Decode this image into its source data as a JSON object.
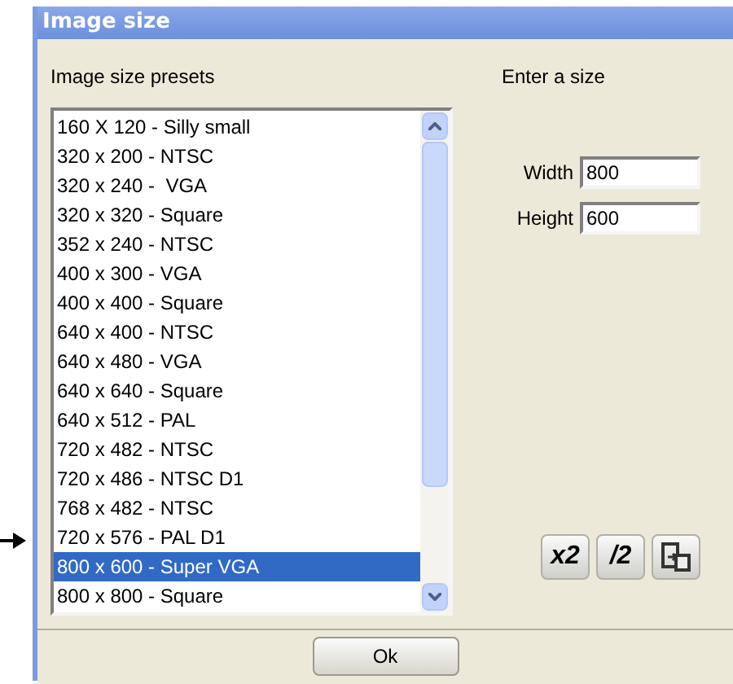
{
  "window": {
    "title": "Image size"
  },
  "presets": {
    "label": "Image size presets",
    "items": [
      {
        "label": "160 X 120 - Silly small",
        "selected": false
      },
      {
        "label": "320 x 200 - NTSC",
        "selected": false
      },
      {
        "label": "320 x 240 -  VGA",
        "selected": false
      },
      {
        "label": "320 x 320 - Square",
        "selected": false
      },
      {
        "label": "352 x 240 - NTSC",
        "selected": false
      },
      {
        "label": "400 x 300 - VGA",
        "selected": false
      },
      {
        "label": "400 x 400 - Square",
        "selected": false
      },
      {
        "label": "640 x 400 - NTSC",
        "selected": false
      },
      {
        "label": "640 x 480 - VGA",
        "selected": false
      },
      {
        "label": "640 x 640 - Square",
        "selected": false
      },
      {
        "label": "640 x 512 - PAL",
        "selected": false
      },
      {
        "label": "720 x 482 - NTSC",
        "selected": false
      },
      {
        "label": "720 x 486 - NTSC D1",
        "selected": false
      },
      {
        "label": "768 x 482 - NTSC",
        "selected": false
      },
      {
        "label": "720 x 576 - PAL D1",
        "selected": false
      },
      {
        "label": "800 x 600 - Super VGA",
        "selected": true
      },
      {
        "label": "800 x 800 - Square",
        "selected": false
      }
    ]
  },
  "size": {
    "label": "Enter a size",
    "fields": [
      {
        "label": "Width",
        "value": "800"
      },
      {
        "label": "Height",
        "value": "600"
      }
    ]
  },
  "tool_buttons": [
    {
      "kind": "text",
      "label": "x2"
    },
    {
      "kind": "text",
      "label": "/2"
    },
    {
      "kind": "swap"
    }
  ],
  "ok_button": "Ok"
}
